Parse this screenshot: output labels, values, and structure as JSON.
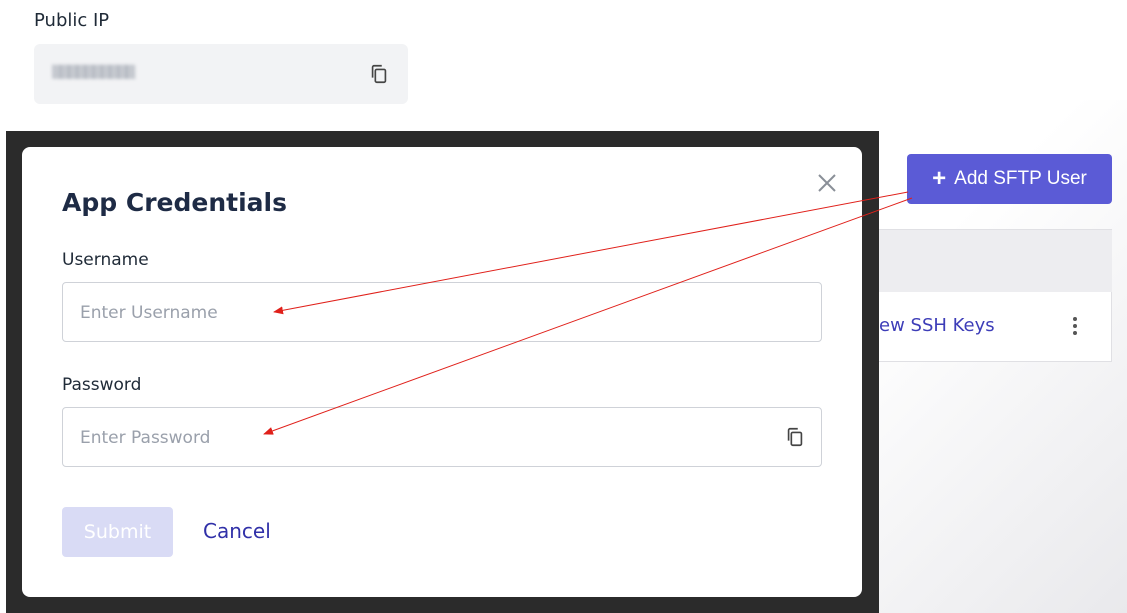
{
  "public_ip": {
    "label": "Public IP",
    "value": "▒▒▒▒▒▒▒▒▒▒",
    "copy_icon": "copy-icon"
  },
  "toolbar": {
    "add_sftp_label": "Add SFTP User",
    "add_icon": "plus-icon"
  },
  "table": {
    "row_link": "ew SSH Keys",
    "row_menu_icon": "more-vertical-icon"
  },
  "modal": {
    "title": "App Credentials",
    "close_icon": "close-icon",
    "username": {
      "label": "Username",
      "placeholder": "Enter Username",
      "value": ""
    },
    "password": {
      "label": "Password",
      "placeholder": "Enter Password",
      "value": "",
      "copy_icon": "copy-icon"
    },
    "submit_label": "Submit",
    "cancel_label": "Cancel"
  },
  "colors": {
    "accent": "#5b5bd6",
    "link": "#3d3db8",
    "overlay": "#2b2b2b",
    "annotation_arrow": "#e0201a",
    "submit_disabled": "#d9dbf5"
  }
}
